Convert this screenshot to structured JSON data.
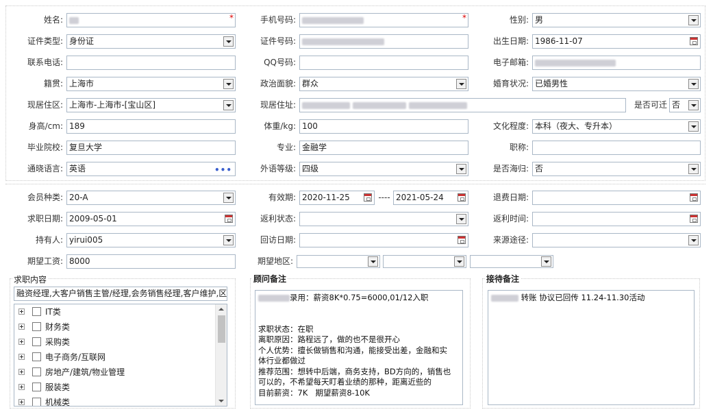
{
  "basic": {
    "name_label": "姓名:",
    "phone_label": "手机号码:",
    "gender_label": "性别:",
    "gender_value": "男",
    "idtype_label": "证件类型:",
    "idtype_value": "身份证",
    "idno_label": "证件号码:",
    "birth_label": "出生日期:",
    "birth_value": "1986-11-07",
    "contact_label": "联系电话:",
    "qq_label": "QQ号码:",
    "email_label": "电子邮箱:",
    "native_label": "籍贯:",
    "native_value": "上海市",
    "political_label": "政治面貌:",
    "political_value": "群众",
    "marital_label": "婚育状况:",
    "marital_value": "已婚男性",
    "region_label": "现居住区:",
    "region_value": "上海市-上海市-[宝山区]",
    "address_label": "现居住址:",
    "relocate_label": "是否可迁",
    "relocate_value": "否",
    "height_label": "身高/cm:",
    "height_value": "189",
    "weight_label": "体重/kg:",
    "weight_value": "100",
    "education_label": "文化程度:",
    "education_value": "本科（夜大、专升本）",
    "school_label": "毕业院校:",
    "school_value": "复旦大学",
    "major_label": "专业:",
    "major_value": "金融学",
    "title_label": "职称:",
    "language_label": "通晓语言:",
    "language_value": "英语",
    "language_more": "•••",
    "foreign_label": "外语等级:",
    "foreign_value": "四级",
    "returnee_label": "是否海归:",
    "returnee_value": "否"
  },
  "member": {
    "type_label": "会员种类:",
    "type_value": "20-A",
    "valid_label": "有效期:",
    "valid_from": "2020-11-25",
    "valid_sep": "----",
    "valid_to": "2021-05-24",
    "refund_label": "退费日期:",
    "jobdate_label": "求职日期:",
    "jobdate_value": "2009-05-01",
    "rebate_status_label": "返利状态:",
    "rebate_time_label": "返利时间:",
    "holder_label": "持有人:",
    "holder_value": "yirui005",
    "visit_label": "回访日期:",
    "source_label": "来源途径:",
    "salary_label": "期望工资:",
    "salary_value": "8000",
    "area_label": "期望地区:"
  },
  "job": {
    "title": "求职内容",
    "summary": "融资经理,大客户销售主管/经理,会务销售经理,客户维护,区",
    "categories": [
      "IT类",
      "财务类",
      "采购类",
      "电子商务/互联网",
      "房地产/建筑/物业管理",
      "服装类",
      "机械类"
    ]
  },
  "advisor": {
    "title": "顾问备注",
    "line1": "录用：薪资8K*0.75=6000,01/12入职",
    "line2": "求职状态：在职",
    "line3": "离职原因：路程远了，做的也不是很开心",
    "line4": "个人优势：擅长做销售和沟通，能接受出差，金融和实",
    "line5": "体行业都做过",
    "line6": "推荐范围：想转中后端，商务支持，BD方向的，销售也",
    "line7": "可以的，不希望每天盯着业绩的那种，距离近些的",
    "line8": "目前薪资：7K   期望薪资8-10K"
  },
  "reception": {
    "title": "接待备注",
    "note": "转账 协议已回传 11.24-11.30活动"
  }
}
